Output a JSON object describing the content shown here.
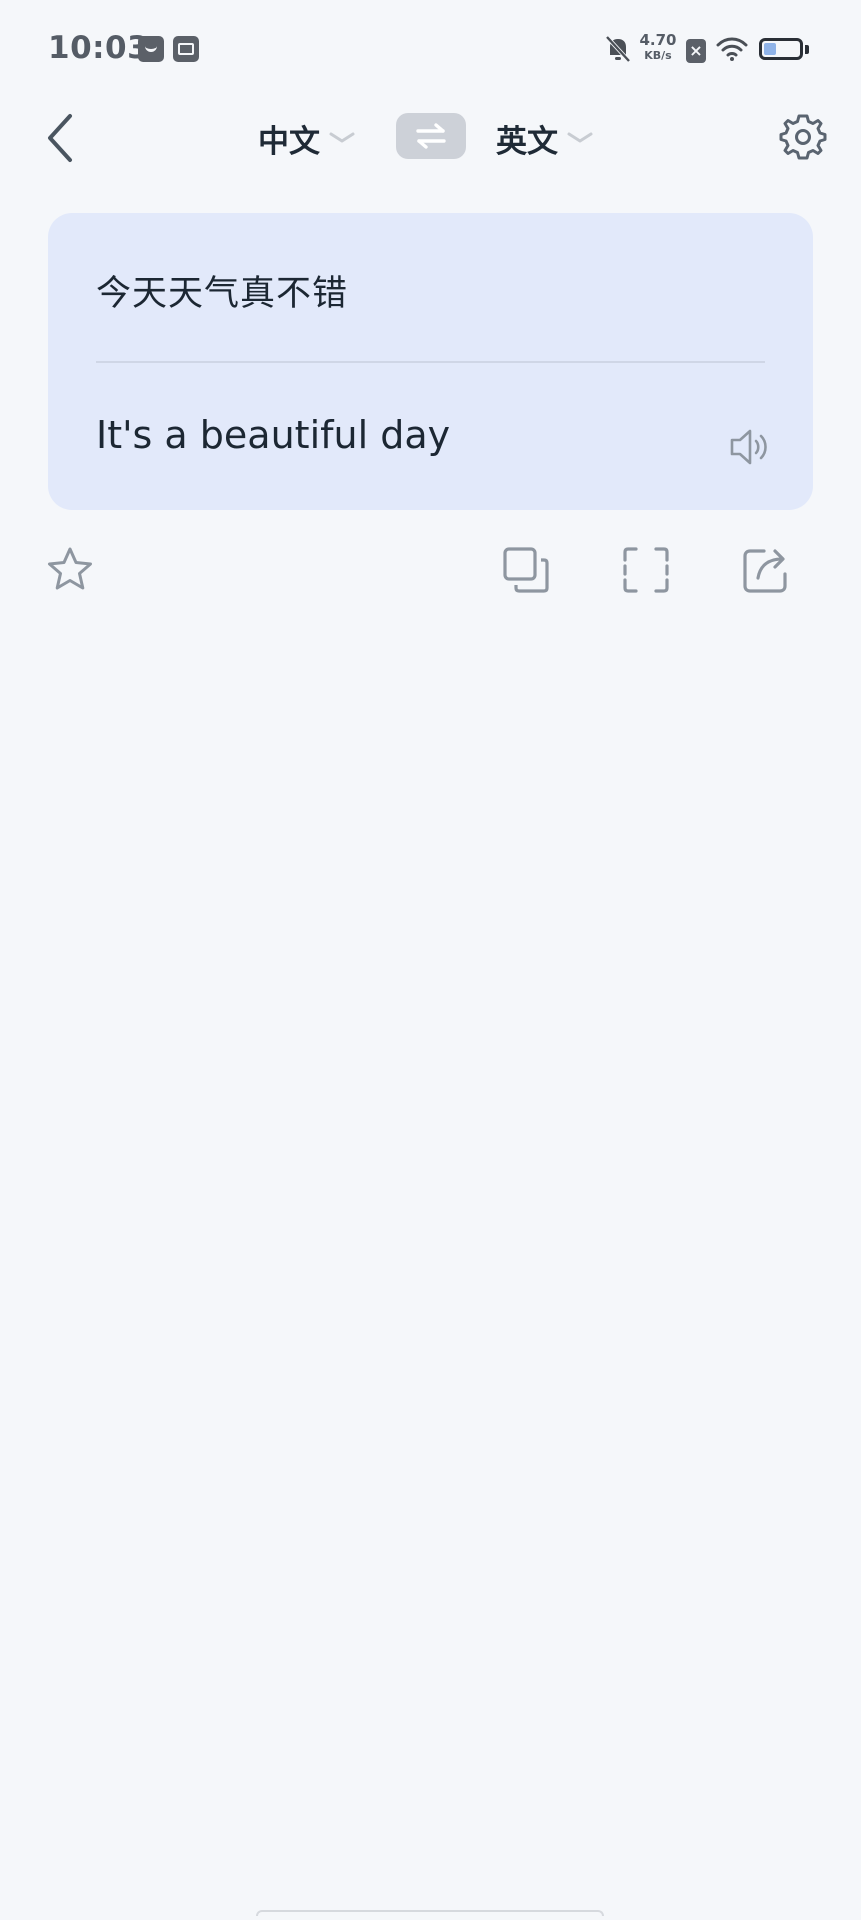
{
  "status_bar": {
    "time": "10:03",
    "net_speed_value": "4.70",
    "net_speed_unit": "KB/s",
    "sim_label": "×",
    "battery_level": 0.35,
    "icons": [
      "mail-icon",
      "archive-icon",
      "bell-off-icon",
      "sim-icon",
      "wifi-icon",
      "battery-icon"
    ]
  },
  "header": {
    "source_language": "中文",
    "target_language": "英文",
    "icons": [
      "back-arrow-icon",
      "chevron-down-icon",
      "swap-icon",
      "gear-icon"
    ]
  },
  "card": {
    "source_text": "今天天气真不错",
    "translated_text": "It's a beautiful day",
    "icons": [
      "speaker-icon"
    ]
  },
  "actions": {
    "icons": [
      "star-icon",
      "copy-icon",
      "fullscreen-icon",
      "share-icon"
    ]
  },
  "colors": {
    "background": "#f5f7fa",
    "card_background": "#e2e9fa",
    "swap_button": "#cdd1d8",
    "icon_gray": "#8a929c",
    "text_dark": "#1c2733"
  }
}
